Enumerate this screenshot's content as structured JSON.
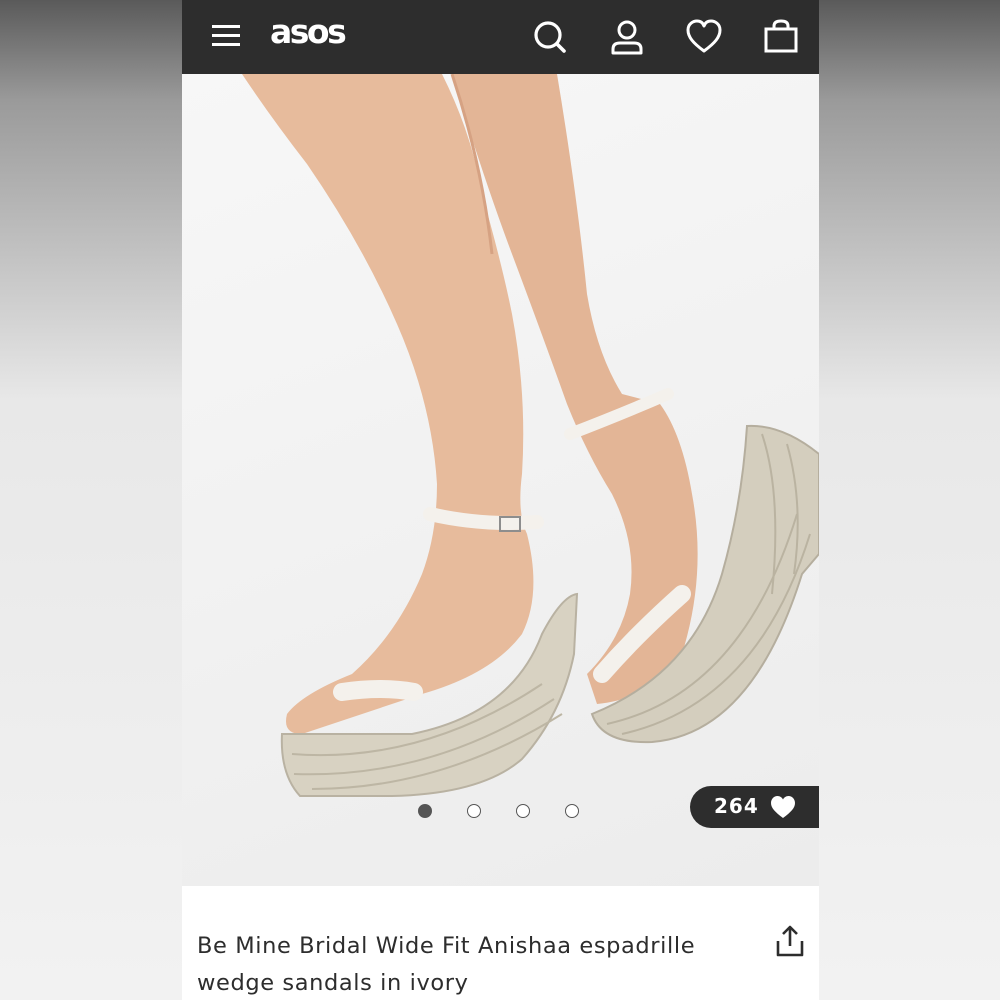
{
  "header": {
    "logo": "asos",
    "icons": [
      "menu-icon",
      "search-icon",
      "account-icon",
      "wishlist-heart-icon",
      "bag-icon"
    ],
    "background": "#2d2d2d",
    "foreground": "#ffffff"
  },
  "gallery": {
    "image_description_icon": "product-photo",
    "dots_count": 4,
    "active_index": 0,
    "saves_count": "264"
  },
  "product": {
    "title": "Be Mine Bridal Wide Fit Anishaa espadrille wedge sandals in ivory"
  }
}
